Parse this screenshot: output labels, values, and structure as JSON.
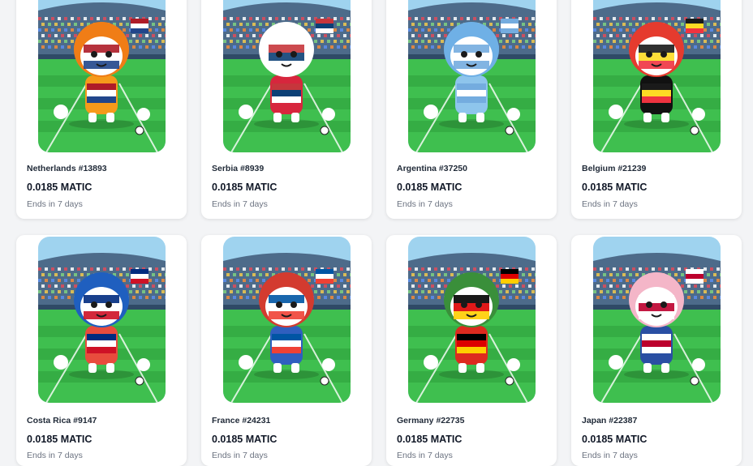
{
  "listings": [
    {
      "name": "Netherlands #13893",
      "price": "0.0185 MATIC",
      "ends": "Ends in 7 days",
      "sky": "#9fd3ef",
      "flag": [
        "#ae1c28",
        "#ffffff",
        "#21468b"
      ],
      "char": "#f59a1b",
      "hair": "#f07d16"
    },
    {
      "name": "Serbia #8939",
      "price": "0.0185 MATIC",
      "ends": "Ends in 7 days",
      "sky": "#9fd3ef",
      "flag": [
        "#c6363c",
        "#0c4076",
        "#ffffff"
      ],
      "char": "#d7263d",
      "hair": "#ffffff"
    },
    {
      "name": "Argentina #37250",
      "price": "0.0185 MATIC",
      "ends": "Ends in 7 days",
      "sky": "#9fd3ef",
      "flag": [
        "#74acdf",
        "#ffffff",
        "#74acdf"
      ],
      "char": "#8ec5ec",
      "hair": "#6fb0e6"
    },
    {
      "name": "Belgium #21239",
      "price": "0.0185 MATIC",
      "ends": "Ends in 7 days",
      "sky": "#9fd3ef",
      "flag": [
        "#1a1a1a",
        "#fdda24",
        "#ef3340"
      ],
      "char": "#111111",
      "hair": "#e53b2e"
    },
    {
      "name": "Costa Rica #9147",
      "price": "0.0185 MATIC",
      "ends": "Ends in 7 days",
      "sky": "#9fd3ef",
      "flag": [
        "#002b7f",
        "#ffffff",
        "#ce1126"
      ],
      "char": "#e84c3d",
      "hair": "#1f5fbf"
    },
    {
      "name": "France #24231",
      "price": "0.0185 MATIC",
      "ends": "Ends in 7 days",
      "sky": "#9fd3ef",
      "flag": [
        "#0055a4",
        "#ffffff",
        "#ef4135"
      ],
      "char": "#2f5fbf",
      "hair": "#d33b2f"
    },
    {
      "name": "Germany #22735",
      "price": "0.0185 MATIC",
      "ends": "Ends in 7 days",
      "sky": "#9fd3ef",
      "flag": [
        "#000000",
        "#dd0000",
        "#ffce00"
      ],
      "char": "#dd2a1f",
      "hair": "#3a8f3a"
    },
    {
      "name": "Japan #22387",
      "price": "0.0185 MATIC",
      "ends": "Ends in 7 days",
      "sky": "#9fd3ef",
      "flag": [
        "#ffffff",
        "#bc002d",
        "#ffffff"
      ],
      "char": "#2a4fa3",
      "hair": "#f4b6c8"
    }
  ]
}
